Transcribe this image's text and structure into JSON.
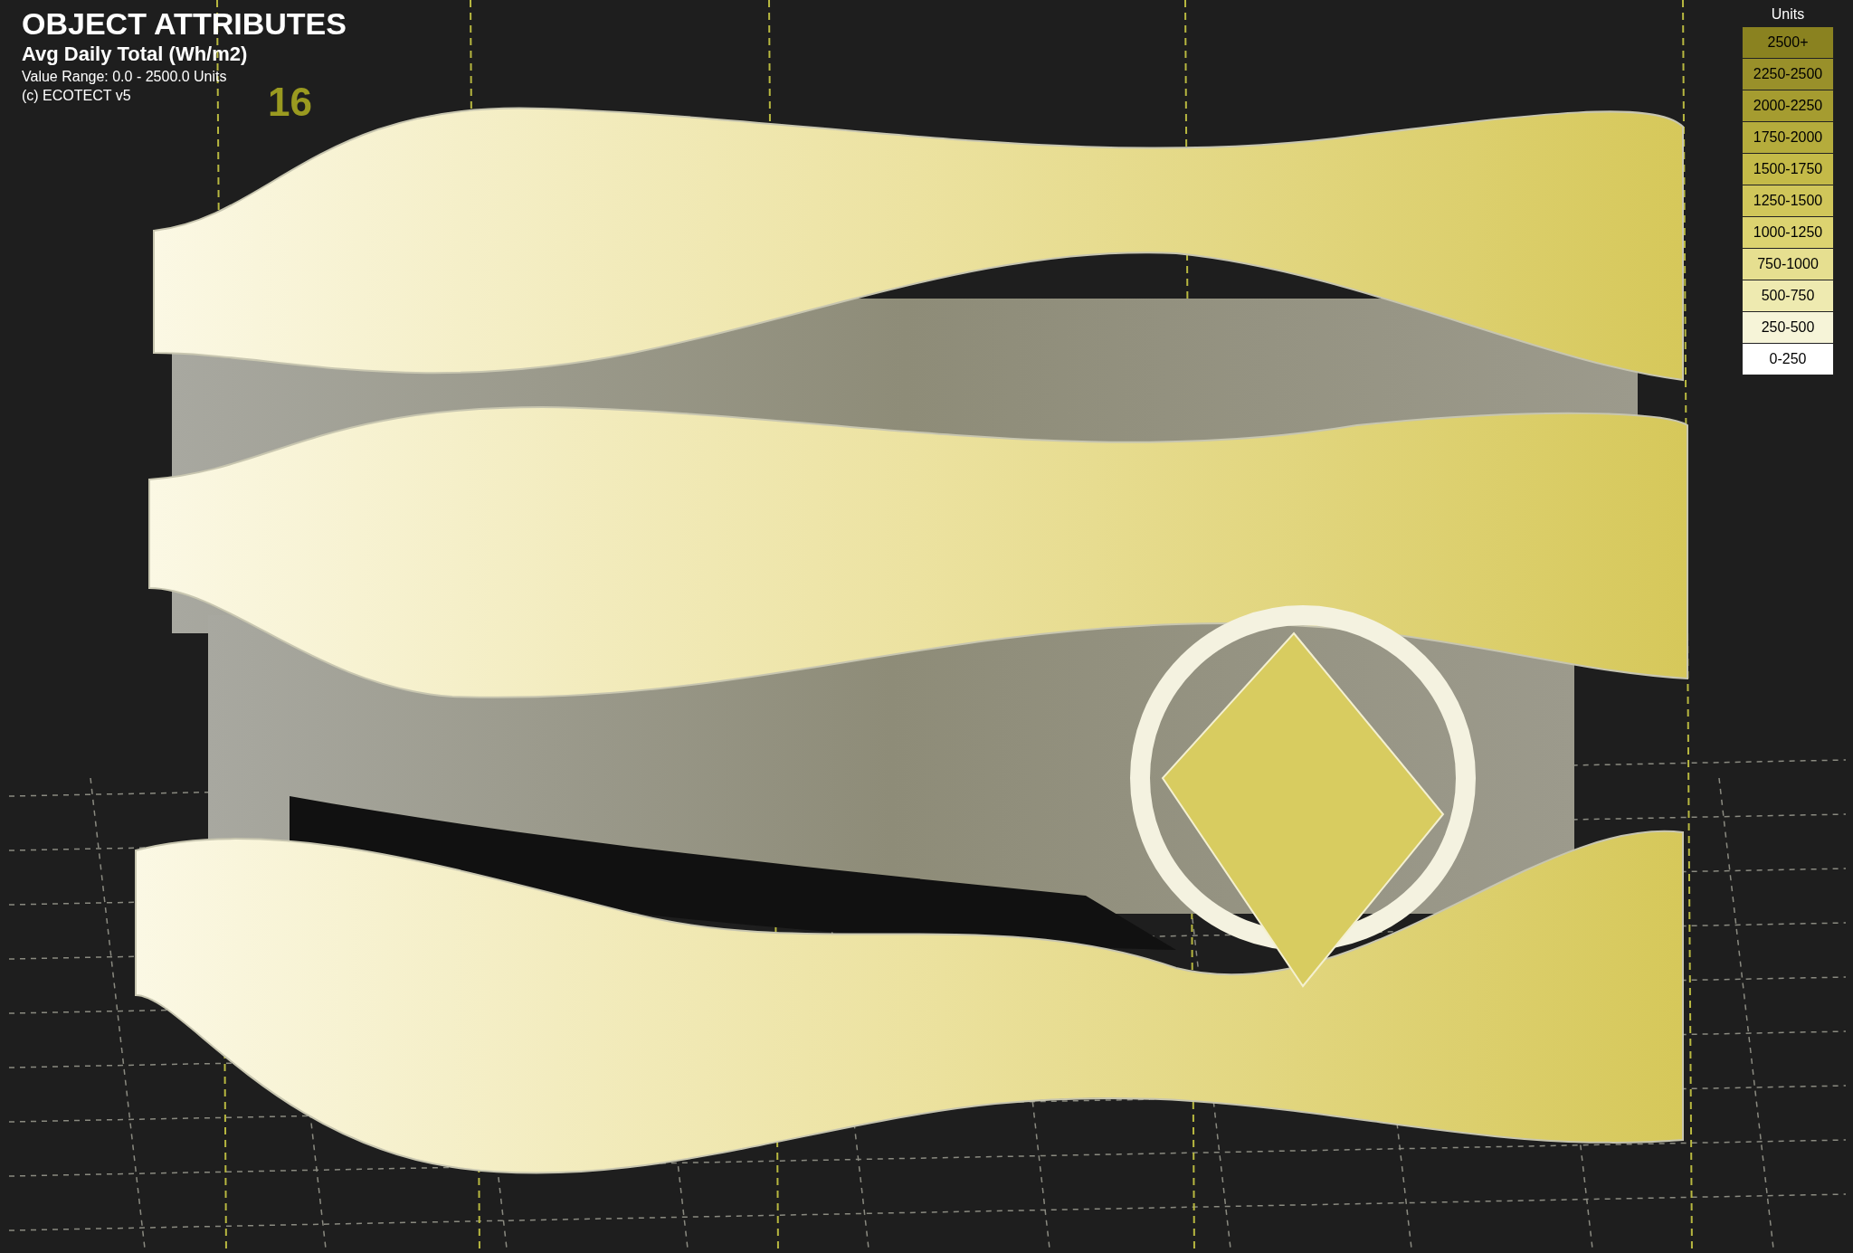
{
  "view": {
    "title": "OBJECT ATTRIBUTES",
    "subtitle": "Avg Daily Total (Wh/m2)",
    "value_range": "Value Range: 0.0 - 2500.0 Units",
    "copyright": "(c) ECOTECT v5",
    "marker": "16"
  },
  "legend": {
    "title": "Units",
    "items": [
      {
        "label": "2500+",
        "color": "#8a8220"
      },
      {
        "label": "2250-2500",
        "color": "#99902a"
      },
      {
        "label": "2000-2250",
        "color": "#a59c30"
      },
      {
        "label": "1750-2000",
        "color": "#b5ac3c"
      },
      {
        "label": "1500-1750",
        "color": "#c4ba48"
      },
      {
        "label": "1250-1500",
        "color": "#d0c65a"
      },
      {
        "label": "1000-1250",
        "color": "#dcd370"
      },
      {
        "label": "750-1000",
        "color": "#e6df90"
      },
      {
        "label": "500-750",
        "color": "#eeeab0"
      },
      {
        "label": "250-500",
        "color": "#f6f4d8"
      },
      {
        "label": "0-250",
        "color": "#ffffff"
      }
    ]
  }
}
